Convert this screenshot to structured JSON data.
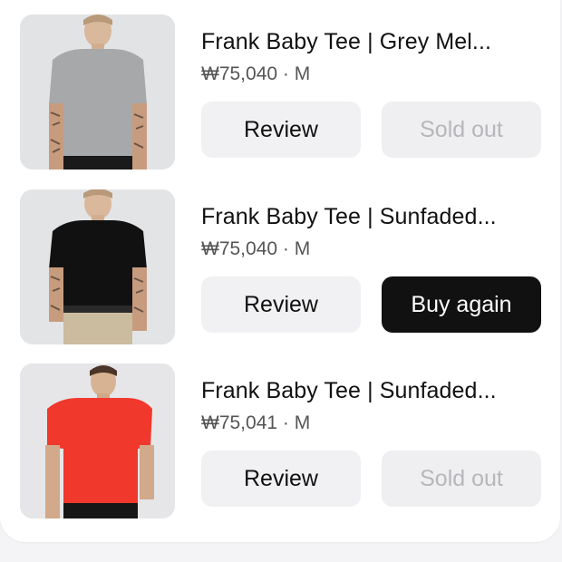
{
  "orders": [
    {
      "title": "Frank Baby Tee | Grey Mel...",
      "price": "₩75,040 · M",
      "review_label": "Review",
      "action_label": "Sold out",
      "shirt_color": "#a6a8aa"
    },
    {
      "title": "Frank Baby Tee | Sunfaded...",
      "price": "₩75,040 · M",
      "review_label": "Review",
      "action_label": "Buy again",
      "shirt_color": "#111111"
    },
    {
      "title": "Frank Baby Tee | Sunfaded...",
      "price": "₩75,041 · M",
      "review_label": "Review",
      "action_label": "Sold out",
      "shirt_color": "#f0382c"
    }
  ]
}
